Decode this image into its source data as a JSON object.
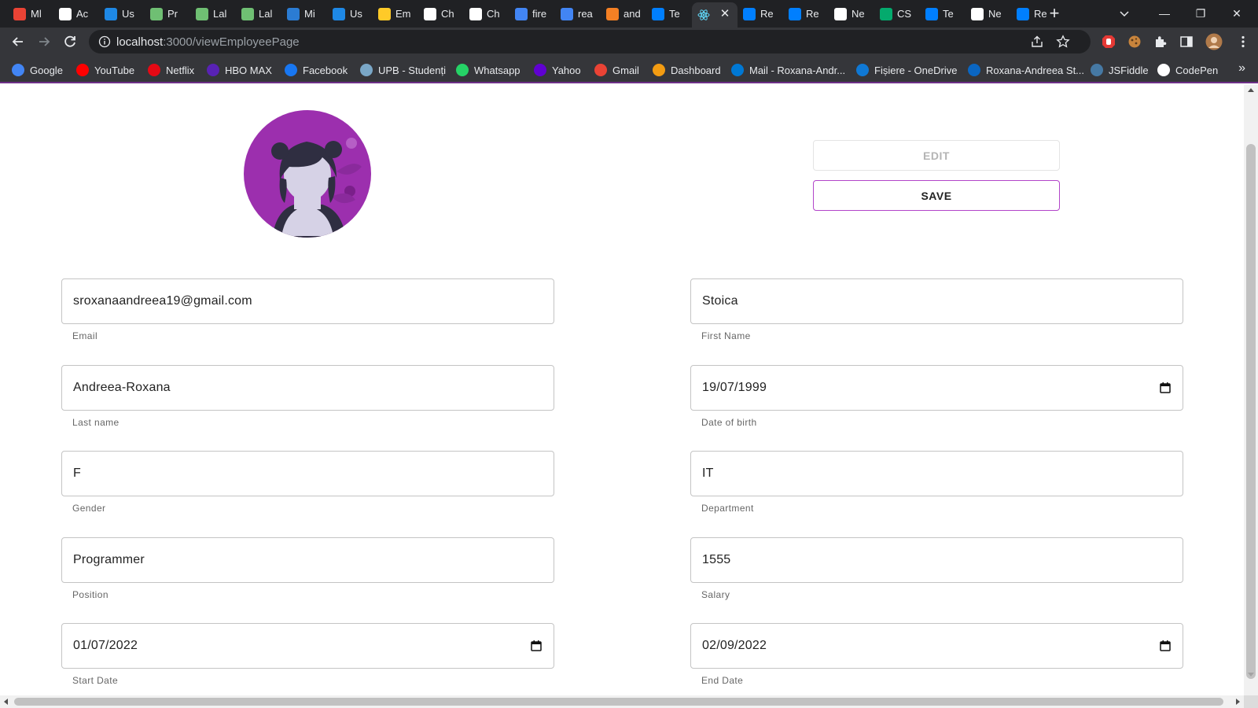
{
  "browser": {
    "tabs": [
      {
        "label": "Ml",
        "icon": "gmail-icon",
        "color": "#ea4335"
      },
      {
        "label": "Ac",
        "icon": "github-icon",
        "color": "#ffffff"
      },
      {
        "label": "Us",
        "icon": "stackoverflow-icon",
        "color": "#1e88e5"
      },
      {
        "label": "Pr",
        "icon": "lab-icon",
        "color": "#6fbf73"
      },
      {
        "label": "Lal",
        "icon": "lab-icon",
        "color": "#6fbf73"
      },
      {
        "label": "Lal",
        "icon": "lab-icon",
        "color": "#6fbf73"
      },
      {
        "label": "Mi",
        "icon": "microsoft-icon",
        "color": "#2b7cd3"
      },
      {
        "label": "Us",
        "icon": "stackoverflow-icon",
        "color": "#1e88e5"
      },
      {
        "label": "Em",
        "icon": "firebase-icon",
        "color": "#ffca28"
      },
      {
        "label": "Ch",
        "icon": "medium-icon",
        "color": "#ffffff"
      },
      {
        "label": "Ch",
        "icon": "medium-icon",
        "color": "#ffffff"
      },
      {
        "label": "fire",
        "icon": "google-icon",
        "color": "#4285f4"
      },
      {
        "label": "rea",
        "icon": "google-icon",
        "color": "#4285f4"
      },
      {
        "label": "and",
        "icon": "stackoverflow-orange-icon",
        "color": "#f48024"
      },
      {
        "label": "Te",
        "icon": "mui-icon",
        "color": "#007fff"
      },
      {
        "label": "",
        "icon": "react-icon",
        "color": "#61dafb",
        "active": true
      },
      {
        "label": "Re",
        "icon": "mui-icon",
        "color": "#007fff"
      },
      {
        "label": "Re",
        "icon": "mui-icon",
        "color": "#007fff"
      },
      {
        "label": "Ne",
        "icon": "github-icon",
        "color": "#ffffff"
      },
      {
        "label": "CS",
        "icon": "w3schools-icon",
        "color": "#04aa6d"
      },
      {
        "label": "Te",
        "icon": "mui-icon",
        "color": "#007fff"
      },
      {
        "label": "Ne",
        "icon": "github-icon",
        "color": "#ffffff"
      },
      {
        "label": "Re",
        "icon": "mui-icon",
        "color": "#007fff"
      }
    ],
    "url_host": "localhost",
    "url_path": ":3000/viewEmployeePage",
    "bookmarks": [
      {
        "label": "Google",
        "icon": "google-icon",
        "color": "#4285f4"
      },
      {
        "label": "YouTube",
        "icon": "youtube-icon",
        "color": "#ff0000"
      },
      {
        "label": "Netflix",
        "icon": "netflix-icon",
        "color": "#e50914"
      },
      {
        "label": "HBO MAX",
        "icon": "hbomax-icon",
        "color": "#5822b4"
      },
      {
        "label": "Facebook",
        "icon": "facebook-icon",
        "color": "#1877f2"
      },
      {
        "label": "UPB - Studenți",
        "icon": "upb-icon",
        "color": "#7aa7c7"
      },
      {
        "label": "Whatsapp",
        "icon": "whatsapp-icon",
        "color": "#25d366"
      },
      {
        "label": "Yahoo",
        "icon": "yahoo-icon",
        "color": "#6001d2"
      },
      {
        "label": "Gmail",
        "icon": "gmail-icon",
        "color": "#ea4335"
      },
      {
        "label": "Dashboard",
        "icon": "dashboard-icon",
        "color": "#f39c12"
      },
      {
        "label": "Mail - Roxana-Andr...",
        "icon": "outlook-icon",
        "color": "#0078d4"
      },
      {
        "label": "Fișiere - OneDrive",
        "icon": "onedrive-icon",
        "color": "#0f78d4"
      },
      {
        "label": "Roxana-Andreea St...",
        "icon": "linkedin-icon",
        "color": "#0a66c2"
      },
      {
        "label": "JSFiddle",
        "icon": "jsfiddle-icon",
        "color": "#4679a4"
      },
      {
        "label": "CodePen",
        "icon": "codepen-icon",
        "color": "#ffffff"
      }
    ],
    "bookmarks_more": "»"
  },
  "page": {
    "edit_label": "EDIT",
    "save_label": "SAVE",
    "fields": [
      {
        "id": "email",
        "value": "sroxanaandreea19@gmail.com",
        "label": "Email",
        "date": false
      },
      {
        "id": "first-name",
        "value": "Stoica",
        "label": "First Name",
        "date": false
      },
      {
        "id": "last-name",
        "value": "Andreea-Roxana",
        "label": "Last name",
        "date": false
      },
      {
        "id": "date-of-birth",
        "value": "19/07/1999",
        "label": "Date of birth",
        "date": true
      },
      {
        "id": "gender",
        "value": "F",
        "label": "Gender",
        "date": false
      },
      {
        "id": "department",
        "value": "IT",
        "label": "Department",
        "date": false
      },
      {
        "id": "position",
        "value": "Programmer",
        "label": "Position",
        "date": false
      },
      {
        "id": "salary",
        "value": "1555",
        "label": "Salary",
        "date": false
      },
      {
        "id": "start-date",
        "value": "01/07/2022",
        "label": "Start Date",
        "date": true
      },
      {
        "id": "end-date",
        "value": "02/09/2022",
        "label": "End Date",
        "date": true
      }
    ]
  },
  "colors": {
    "accent": "#b245c9",
    "avatar_bg": "#9c2fae",
    "chrome_dark": "#202124",
    "chrome_toolbar": "#35363a"
  }
}
